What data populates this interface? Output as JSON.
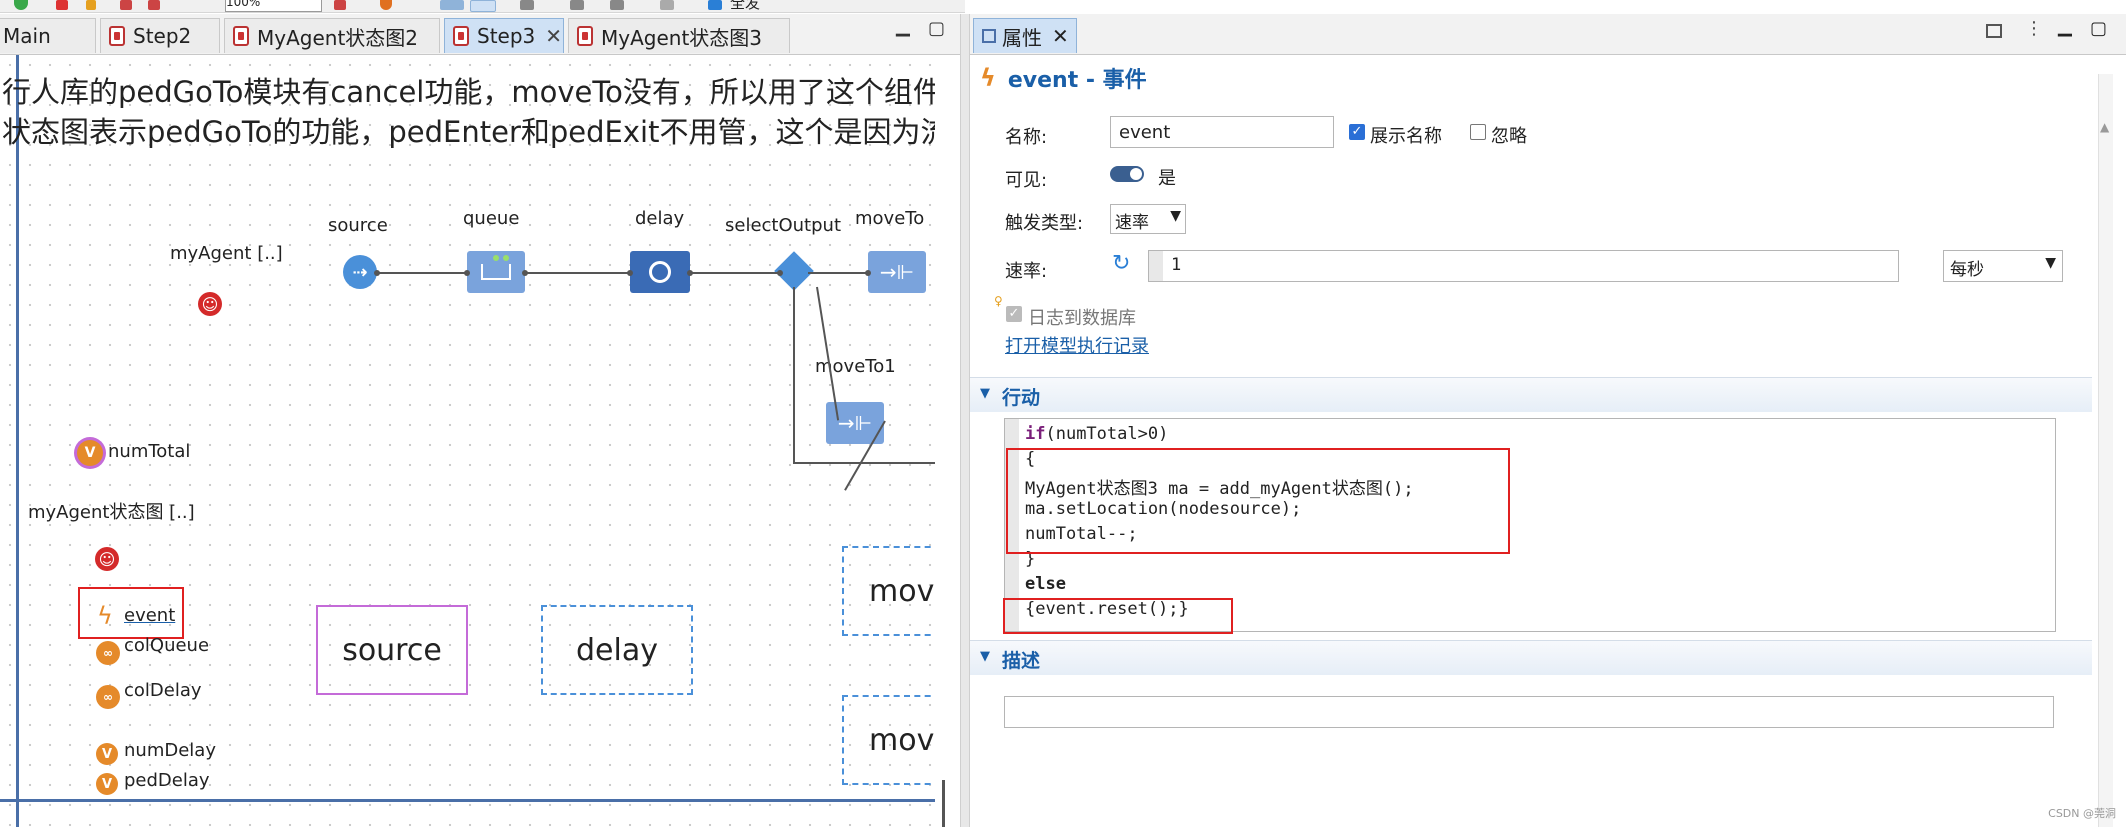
{
  "toolbar": {
    "zoom_value": "100%",
    "extra_label": "全发"
  },
  "editor_tabs": [
    {
      "label": "Main",
      "active": false
    },
    {
      "label": "Step2",
      "active": false
    },
    {
      "label": "MyAgent状态图2",
      "active": false
    },
    {
      "label": "Step3",
      "active": true
    },
    {
      "label": "MyAgent状态图3",
      "active": false
    }
  ],
  "canvas": {
    "text_line1": "行人库的pedGoTo模块有cancel功能，moveTo没有，所以用了这个组件",
    "text_line2": "状态图表示pedGoTo的功能，pedEnter和pedExit不用管，这个是因为流",
    "blocks": {
      "source": "source",
      "queue": "queue",
      "delay": "delay",
      "selectOutput": "selectOutput",
      "moveTo": "moveTo",
      "moveTo1": "moveTo1"
    },
    "myAgent_label": "myAgent [..]",
    "numTotal_label": "numTotal",
    "myAgent_statechart_label": "myAgent状态图 [..]",
    "event_label": "event",
    "colQueue_label": "colQueue",
    "colDelay_label": "colDelay",
    "numDelay_label": "numDelay",
    "pedDelay_label": "pedDelay",
    "box_source": "source",
    "box_delay": "delay",
    "box_mov1": "mov",
    "box_mov2": "mov"
  },
  "props": {
    "tab_label": "属性",
    "title": "event - 事件",
    "name_label": "名称:",
    "name_value": "event",
    "show_name_label": "展示名称",
    "show_name_checked": true,
    "ignore_label": "忽略",
    "ignore_checked": false,
    "visible_label": "可见:",
    "visible_value": "是",
    "trigger_label": "触发类型:",
    "trigger_value": "速率",
    "rate_label": "速率:",
    "rate_value": "1",
    "rate_unit": "每秒",
    "log_label": "日志到数据库",
    "open_log_link": "打开模型执行记录",
    "section_action": "行动",
    "section_desc": "描述",
    "code_lines": [
      "if(numTotal>0)",
      "{",
      "MyAgent状态图3 ma = add_myAgent状态图();",
      "ma.setLocation(nodesource);",
      "numTotal--;",
      "}",
      "else",
      "{event.reset();}"
    ],
    "description_value": ""
  },
  "watermark": "CSDN @莞洞",
  "colors": {
    "accent_blue": "#1a5fa8",
    "block_blue": "#6f9bd8",
    "block_dark": "#3a6bb5",
    "highlight_red": "#e02020"
  }
}
